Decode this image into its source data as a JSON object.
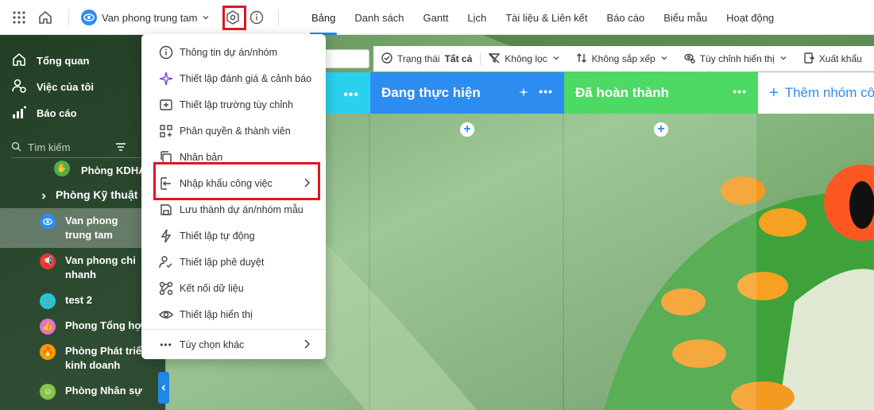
{
  "project": {
    "name": "Van phong trung tam"
  },
  "tabs": [
    "Bảng",
    "Danh sách",
    "Gantt",
    "Lịch",
    "Tài liệu & Liên kết",
    "Báo cáo",
    "Biểu mẫu",
    "Hoạt động"
  ],
  "sidebar": {
    "nav": [
      {
        "label": "Tổng quan",
        "icon": "home-icon"
      },
      {
        "label": "Việc của tôi",
        "icon": "user-tasks-icon"
      },
      {
        "label": "Báo cáo",
        "icon": "chart-icon"
      }
    ],
    "search_placeholder": "Tìm kiếm",
    "group_label": "Phòng Kỹ thuật",
    "items": [
      {
        "label": "Phòng KDHA",
        "color": "#4caf50"
      },
      {
        "label": "Van phong trung tam",
        "color": "#2d8cf0"
      },
      {
        "label": "Van phong chi nhanh",
        "color": "#e53935"
      },
      {
        "label": "test 2",
        "color": "#26c6da"
      },
      {
        "label": "Phong Tổng hợp",
        "color": "#e573c9"
      },
      {
        "label": "Phòng Phát triển kinh doanh",
        "color": "#ff9800"
      },
      {
        "label": "Phòng Nhân sự",
        "color": "#8bc34a"
      }
    ]
  },
  "toolbar": {
    "status_label": "Trạng thái",
    "status_value": "Tất cả",
    "filter": "Không lọc",
    "sort": "Không sắp xếp",
    "display": "Tùy chỉnh hiển thị",
    "export": "Xuất khẩu"
  },
  "columns": [
    {
      "title": "Đang thực hiện",
      "color": "#2d8cf0"
    },
    {
      "title": "Đã hoàn thành",
      "color": "#4cd964"
    },
    {
      "title": "Thêm nhóm cô",
      "color": "#ffffff"
    }
  ],
  "menu": {
    "items": [
      {
        "label": "Thông tin dự án/nhóm",
        "icon": "info-icon"
      },
      {
        "label": "Thiết lập đánh giá & cảnh báo",
        "icon": "sparkle-icon"
      },
      {
        "label": "Thiết lập trường tùy chỉnh",
        "icon": "add-field-icon"
      },
      {
        "label": "Phân quyền & thành viên",
        "icon": "permissions-icon"
      },
      {
        "label": "Nhân bản",
        "icon": "duplicate-icon"
      },
      {
        "label": "Nhập khẩu công việc",
        "icon": "import-icon"
      },
      {
        "label": "Lưu thành dự án/nhóm mẫu",
        "icon": "save-icon"
      },
      {
        "label": "Thiết lập tự động",
        "icon": "bolt-icon"
      },
      {
        "label": "Thiết lập phê duyệt",
        "icon": "approval-icon"
      },
      {
        "label": "Kết nối dữ liệu",
        "icon": "connect-icon"
      },
      {
        "label": "Thiết lập hiển thị",
        "icon": "eye-icon"
      }
    ],
    "more": "Tùy chọn khác"
  }
}
